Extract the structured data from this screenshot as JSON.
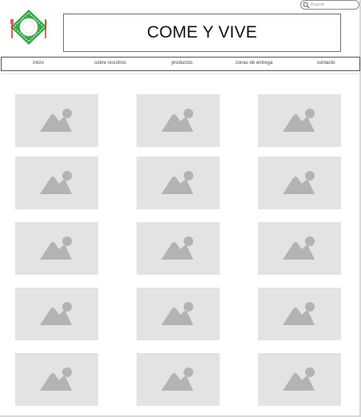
{
  "search": {
    "placeholder": "Buscar"
  },
  "header": {
    "title": "COME Y VIVE"
  },
  "nav": {
    "items": [
      {
        "label": "inicio"
      },
      {
        "label": "sobre nosotros"
      },
      {
        "label": "productos"
      },
      {
        "label": "zonas de entrega"
      },
      {
        "label": "contacto"
      }
    ]
  },
  "gallery": {
    "rows": 5,
    "columns": 3,
    "tile_icon": "image-placeholder-icon"
  },
  "colors": {
    "tile_bg": "#e3e3e3",
    "tile_icon": "#b3b3b3",
    "logo_green": "#35a845",
    "logo_red": "#d43b2f"
  }
}
